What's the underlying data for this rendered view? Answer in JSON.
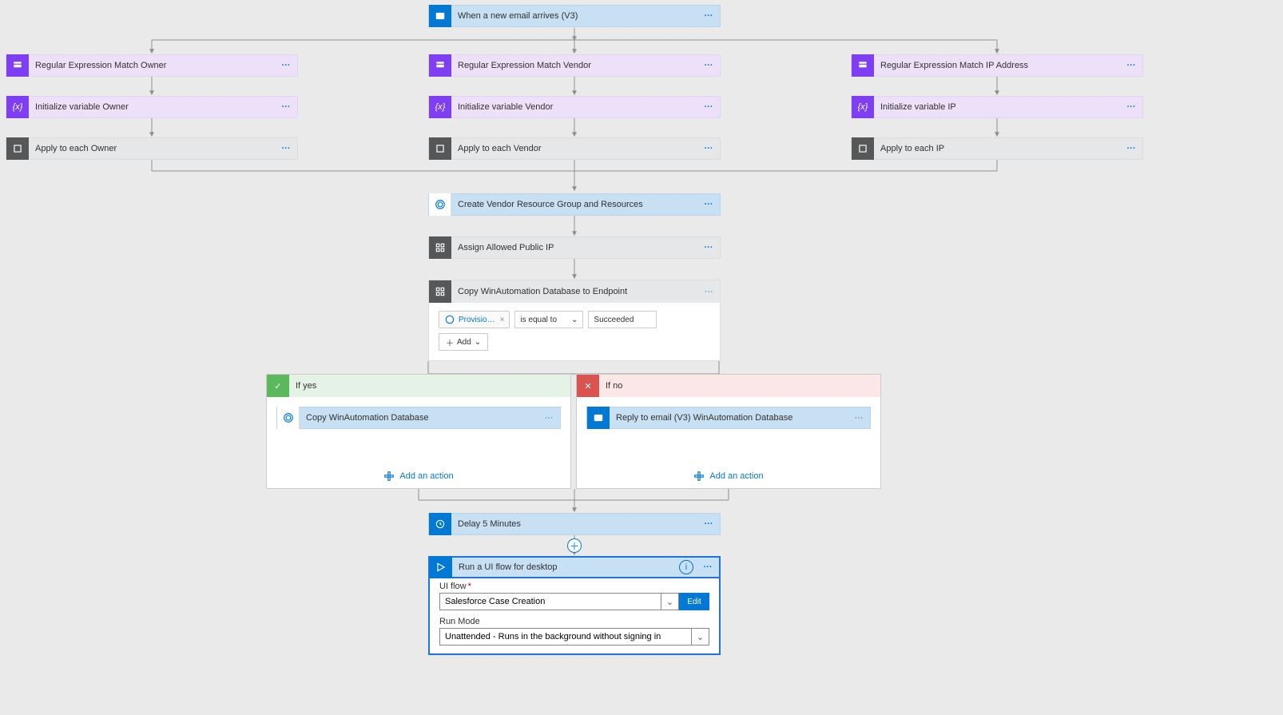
{
  "trigger": {
    "label": "When a new email arrives (V3)"
  },
  "cols": [
    {
      "regex": "Regular Expression Match Owner",
      "init": "Initialize variable Owner",
      "loop": "Apply to each Owner"
    },
    {
      "regex": "Regular Expression Match Vendor",
      "init": "Initialize variable Vendor",
      "loop": "Apply to each Vendor"
    },
    {
      "regex": "Regular Expression Match IP Address",
      "init": "Initialize variable IP",
      "loop": "Apply to each IP"
    }
  ],
  "mid": {
    "create": "Create Vendor Resource Group and Resources",
    "assign": "Assign Allowed Public IP",
    "copy": "Copy WinAutomation Database to Endpoint"
  },
  "cond": {
    "token": "Provisio…",
    "op": "is equal to",
    "value": "Succeeded",
    "add": "Add"
  },
  "yes": {
    "head": "If yes",
    "action": "Copy WinAutomation Database",
    "add": "Add an action"
  },
  "no": {
    "head": "If no",
    "action": "Reply to email (V3) WinAutomation Database",
    "add": "Add an action"
  },
  "delay": {
    "label": "Delay 5 Minutes"
  },
  "ui": {
    "head": "Run a UI flow for desktop",
    "field1_label": "UI flow",
    "field1_value": "Salesforce Case Creation",
    "edit": "Edit",
    "field2_label": "Run Mode",
    "field2_value": "Unattended - Runs in the background without signing in"
  }
}
